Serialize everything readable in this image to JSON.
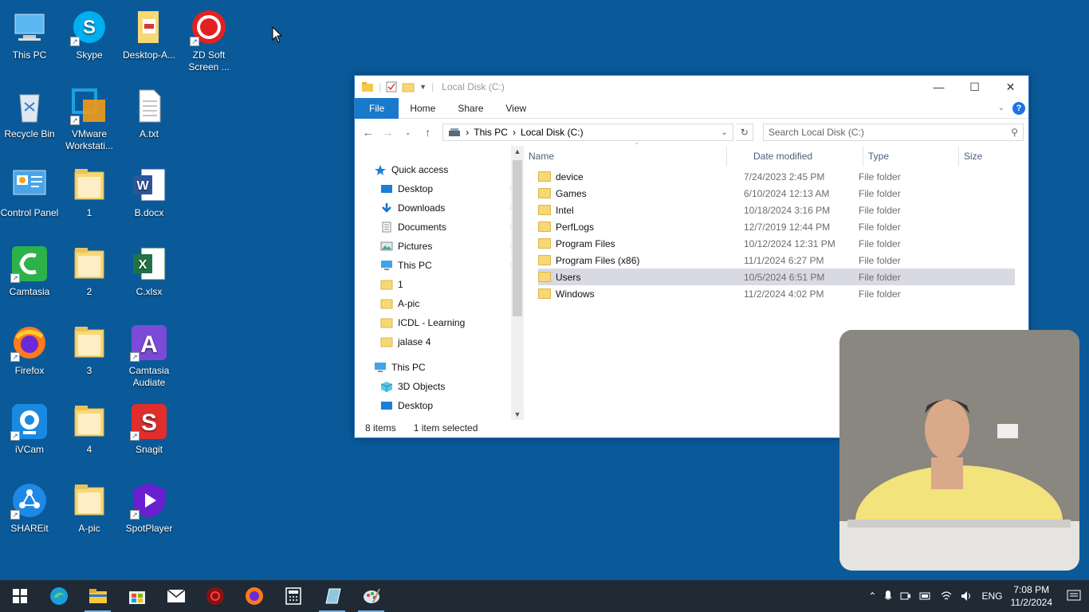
{
  "desktop": {
    "icons": [
      {
        "label": "This PC",
        "icon": "this-pc-icon"
      },
      {
        "label": "Skype",
        "icon": "skype-icon"
      },
      {
        "label": "Desktop-A...",
        "icon": "folder-pdf-icon"
      },
      {
        "label": "ZD Soft Screen ...",
        "icon": "zd-soft-recorder-icon"
      },
      {
        "label": "Recycle Bin",
        "icon": "recycle-bin-icon"
      },
      {
        "label": "VMware Workstati...",
        "icon": "vmware-icon"
      },
      {
        "label": "A.txt",
        "icon": "text-file-icon"
      },
      {
        "label": "Control Panel",
        "icon": "control-panel-icon"
      },
      {
        "label": "1",
        "icon": "folder-icon"
      },
      {
        "label": "B.docx",
        "icon": "word-icon"
      },
      {
        "label": "Camtasia",
        "icon": "camtasia-icon"
      },
      {
        "label": "2",
        "icon": "folder-icon"
      },
      {
        "label": "C.xlsx",
        "icon": "excel-icon"
      },
      {
        "label": "Firefox",
        "icon": "firefox-icon"
      },
      {
        "label": "3",
        "icon": "folder-icon"
      },
      {
        "label": "Camtasia Audiate",
        "icon": "audiate-icon"
      },
      {
        "label": "iVCam",
        "icon": "ivcam-icon"
      },
      {
        "label": "4",
        "icon": "folder-icon"
      },
      {
        "label": "Snagit",
        "icon": "snagit-icon"
      },
      {
        "label": "SHAREit",
        "icon": "shareit-icon"
      },
      {
        "label": "A-pic",
        "icon": "folder-icon"
      },
      {
        "label": "SpotPlayer",
        "icon": "spotplayer-icon"
      }
    ]
  },
  "explorer": {
    "title": "Local Disk (C:)",
    "ribbon": {
      "file": "File",
      "home": "Home",
      "share": "Share",
      "view": "View"
    },
    "address": {
      "crumb1": "This PC",
      "crumb2": "Local Disk (C:)"
    },
    "search_placeholder": "Search Local Disk (C:)",
    "nav": {
      "quick_access": "Quick access",
      "qa_items": [
        "Desktop",
        "Downloads",
        "Documents",
        "Pictures",
        "This PC",
        "1",
        "A-pic",
        "ICDL - Learning",
        "jalase 4"
      ],
      "this_pc": "This PC",
      "pc_items": [
        "3D Objects",
        "Desktop"
      ]
    },
    "columns": {
      "name": "Name",
      "date": "Date modified",
      "type": "Type",
      "size": "Size"
    },
    "rows": [
      {
        "name": "device",
        "date": "7/24/2023 2:45 PM",
        "type": "File folder"
      },
      {
        "name": "Games",
        "date": "6/10/2024 12:13 AM",
        "type": "File folder"
      },
      {
        "name": "Intel",
        "date": "10/18/2024 3:16 PM",
        "type": "File folder"
      },
      {
        "name": "PerfLogs",
        "date": "12/7/2019 12:44 PM",
        "type": "File folder"
      },
      {
        "name": "Program Files",
        "date": "10/12/2024 12:31 PM",
        "type": "File folder"
      },
      {
        "name": "Program Files (x86)",
        "date": "11/1/2024 6:27 PM",
        "type": "File folder"
      },
      {
        "name": "Users",
        "date": "10/5/2024 6:51 PM",
        "type": "File folder",
        "selected": true
      },
      {
        "name": "Windows",
        "date": "11/2/2024 4:02 PM",
        "type": "File folder"
      }
    ],
    "status": {
      "items": "8 items",
      "selected": "1 item selected"
    }
  },
  "taskbar": {
    "apps": [
      "start-icon",
      "edge-icon",
      "file-explorer-icon",
      "store-icon",
      "mail-icon",
      "recorder-icon",
      "firefox-icon",
      "calculator-icon",
      "app-icon",
      "paint-icon"
    ],
    "lang": "ENG",
    "time": "7:08 PM",
    "date": "11/2/2024"
  },
  "colors": {
    "desktop_bg": "#0a5a9a",
    "accent": "#1979ca",
    "selection": "#d9d9e3",
    "folder": "#f8d775"
  }
}
